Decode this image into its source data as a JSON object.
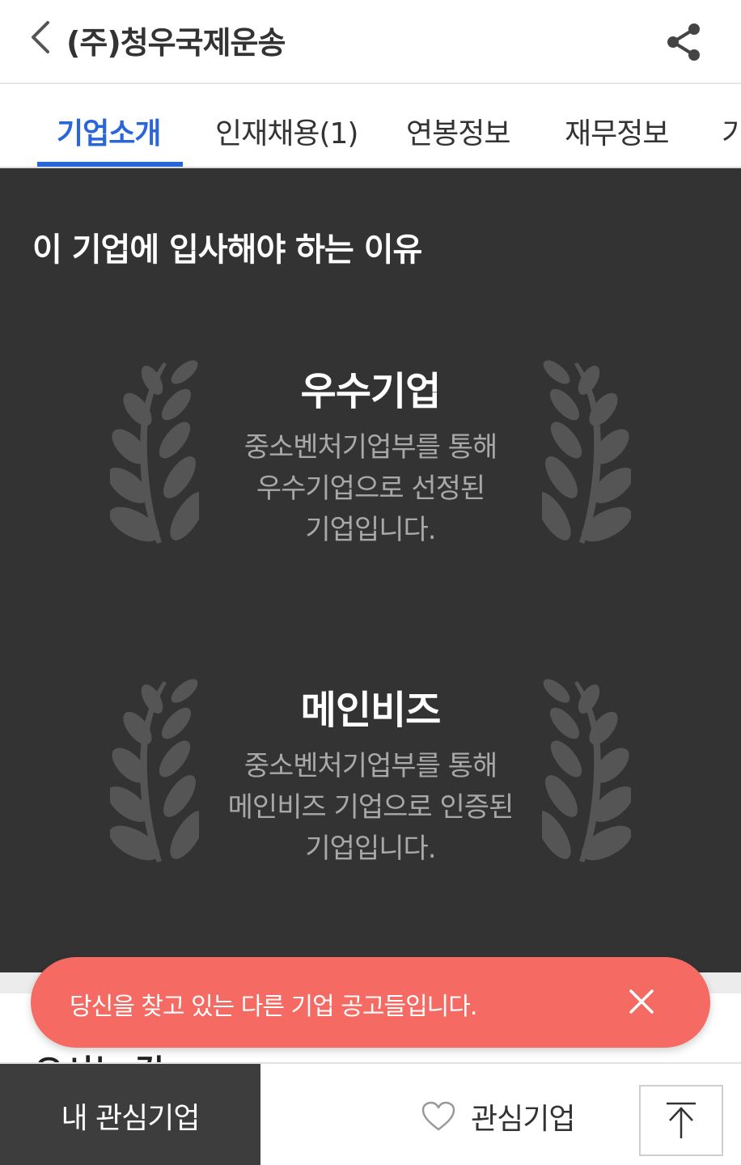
{
  "header": {
    "title": "(주)청우국제운송",
    "back_icon": "chevron-left-icon",
    "share_icon": "share-icon"
  },
  "tabs": [
    {
      "label": "기업소개",
      "active": true
    },
    {
      "label": "인재채용(1)",
      "active": false
    },
    {
      "label": "연봉정보",
      "active": false
    },
    {
      "label": "재무정보",
      "active": false
    },
    {
      "label": "기",
      "active": false
    }
  ],
  "why_join": {
    "title": "이 기업에 입사해야 하는 이유",
    "awards": [
      {
        "title": "우수기업",
        "description": "중소벤처기업부를 통해 우수기업으로 선정된 기업입니다.",
        "icon": "laurel-wreath-icon"
      },
      {
        "title": "메인비즈",
        "description": "중소벤처기업부를 통해 메인비즈 기업으로 인증된 기업입니다.",
        "icon": "laurel-wreath-icon"
      }
    ]
  },
  "next_section_peek": "오시는 길",
  "toast": {
    "message": "당신을 찾고 있는 다른 기업 공고들입니다.",
    "close_icon": "close-icon"
  },
  "bottom_bar": {
    "my_favorites_label": "내 관심기업",
    "favorite_label": "관심기업",
    "favorite_icon": "heart-outline-icon",
    "top_icon": "arrow-up-to-top-icon"
  },
  "colors": {
    "accent": "#2a66d9",
    "dark_bg": "#333333",
    "toast_bg": "#f56a62"
  }
}
